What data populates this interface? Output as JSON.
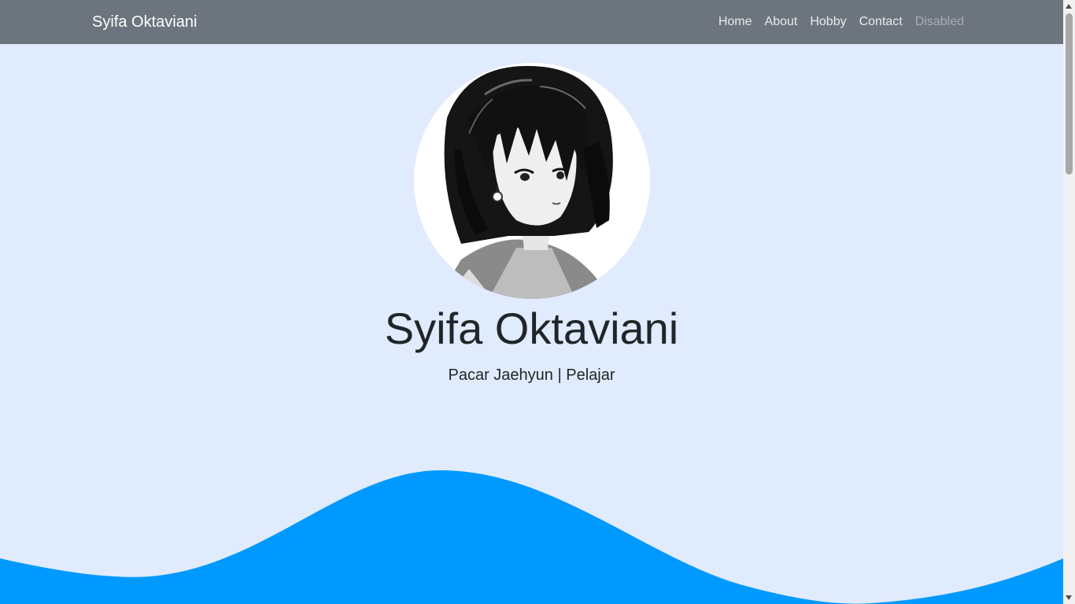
{
  "navbar": {
    "brand": "Syifa Oktaviani",
    "links": [
      {
        "label": "Home"
      },
      {
        "label": "About"
      },
      {
        "label": "Hobby"
      },
      {
        "label": "Contact"
      },
      {
        "label": "Disabled"
      }
    ]
  },
  "hero": {
    "name": "Syifa Oktaviani",
    "subtitle": "Pacar Jaehyun | Pelajar"
  },
  "colors": {
    "navbar_bg": "#6c757d",
    "page_bg": "#e0ebfd",
    "wave": "#0099ff"
  }
}
